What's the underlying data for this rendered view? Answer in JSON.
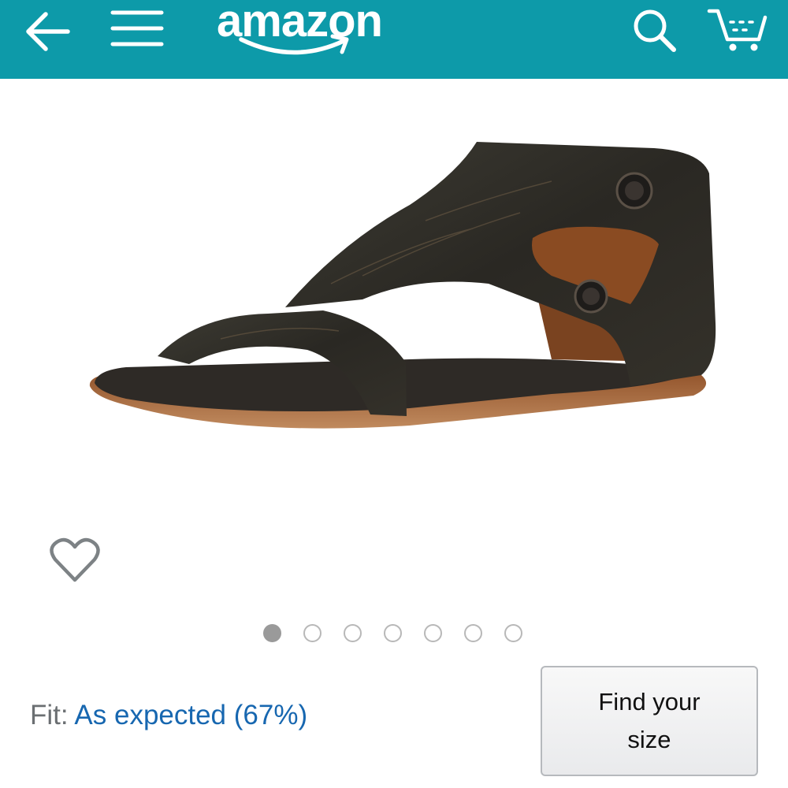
{
  "header": {
    "logo_text": "amazon",
    "background_color": "#0d9aa9",
    "icons": [
      "back-arrow-icon",
      "hamburger-menu-icon",
      "search-icon",
      "cart-icon"
    ]
  },
  "product": {
    "image": "dark-distressed-leather-sandal",
    "carousel": {
      "total": 7,
      "active_index": 1
    }
  },
  "fit": {
    "label": "Fit:",
    "value": "As expected (67%)"
  },
  "find_size_button": {
    "label": "Find your size"
  }
}
